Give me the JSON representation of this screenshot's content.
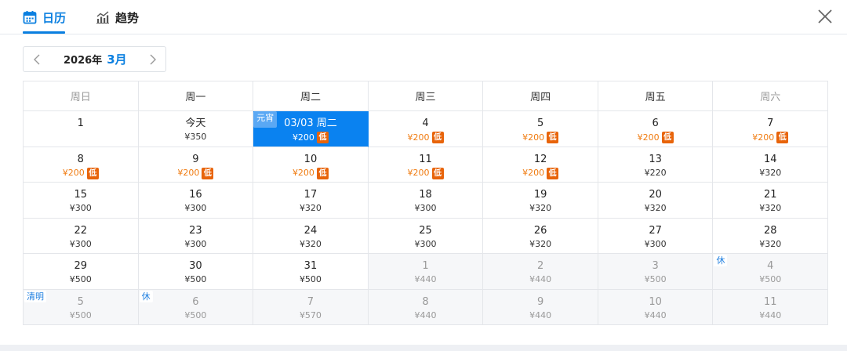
{
  "tabs": [
    {
      "label": "日历",
      "icon": "calendar-icon",
      "active": true
    },
    {
      "label": "趋势",
      "icon": "chart-icon",
      "active": false
    }
  ],
  "nav": {
    "year": "2026年",
    "month": "3月"
  },
  "colors": {
    "accent": "#0a7fe0",
    "selected": "#0a82f0",
    "low_price": "#f07b10",
    "low_badge": "#e8640a"
  },
  "weekdays": [
    "周日",
    "周一",
    "周二",
    "周三",
    "周四",
    "周五",
    "周六"
  ],
  "low_badge": "低",
  "weeks": [
    [
      {
        "day": "1",
        "price": ""
      },
      {
        "day": "今天",
        "price": "¥350"
      },
      {
        "day": "03/03 周二",
        "price": "¥200",
        "low": true,
        "selected": true,
        "tag": "元宵"
      },
      {
        "day": "4",
        "price": "¥200",
        "low": true
      },
      {
        "day": "5",
        "price": "¥200",
        "low": true
      },
      {
        "day": "6",
        "price": "¥200",
        "low": true
      },
      {
        "day": "7",
        "price": "¥200",
        "low": true
      }
    ],
    [
      {
        "day": "8",
        "price": "¥200",
        "low": true
      },
      {
        "day": "9",
        "price": "¥200",
        "low": true
      },
      {
        "day": "10",
        "price": "¥200",
        "low": true
      },
      {
        "day": "11",
        "price": "¥200",
        "low": true
      },
      {
        "day": "12",
        "price": "¥200",
        "low": true
      },
      {
        "day": "13",
        "price": "¥220"
      },
      {
        "day": "14",
        "price": "¥320"
      }
    ],
    [
      {
        "day": "15",
        "price": "¥300"
      },
      {
        "day": "16",
        "price": "¥300"
      },
      {
        "day": "17",
        "price": "¥320"
      },
      {
        "day": "18",
        "price": "¥300"
      },
      {
        "day": "19",
        "price": "¥320"
      },
      {
        "day": "20",
        "price": "¥320"
      },
      {
        "day": "21",
        "price": "¥320"
      }
    ],
    [
      {
        "day": "22",
        "price": "¥300"
      },
      {
        "day": "23",
        "price": "¥300"
      },
      {
        "day": "24",
        "price": "¥320"
      },
      {
        "day": "25",
        "price": "¥300"
      },
      {
        "day": "26",
        "price": "¥320"
      },
      {
        "day": "27",
        "price": "¥300"
      },
      {
        "day": "28",
        "price": "¥320"
      }
    ],
    [
      {
        "day": "29",
        "price": "¥500"
      },
      {
        "day": "30",
        "price": "¥500"
      },
      {
        "day": "31",
        "price": "¥500"
      },
      {
        "day": "1",
        "price": "¥440",
        "other": true
      },
      {
        "day": "2",
        "price": "¥440",
        "other": true
      },
      {
        "day": "3",
        "price": "¥500",
        "other": true
      },
      {
        "day": "4",
        "price": "¥500",
        "other": true,
        "tag": "休"
      }
    ],
    [
      {
        "day": "5",
        "price": "¥500",
        "other": true,
        "tag": "清明"
      },
      {
        "day": "6",
        "price": "¥500",
        "other": true,
        "tag": "休"
      },
      {
        "day": "7",
        "price": "¥570",
        "other": true
      },
      {
        "day": "8",
        "price": "¥440",
        "other": true
      },
      {
        "day": "9",
        "price": "¥440",
        "other": true
      },
      {
        "day": "10",
        "price": "¥440",
        "other": true
      },
      {
        "day": "11",
        "price": "¥440",
        "other": true
      }
    ]
  ]
}
